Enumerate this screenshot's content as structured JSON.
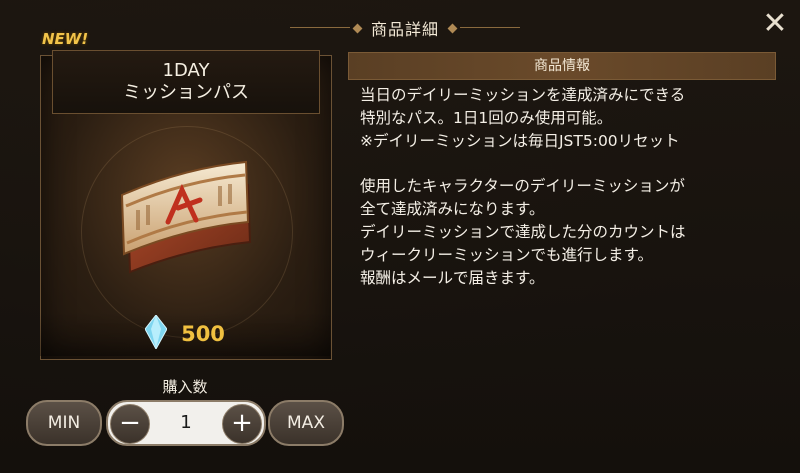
{
  "dialog": {
    "title": "商品詳細",
    "close_glyph": "✕"
  },
  "product": {
    "badge": "NEW!",
    "name_line1": "1DAY",
    "name_line2": "ミッションパス",
    "item_icon": "red-band-ticket-icon",
    "currency_icon": "crystal-icon",
    "price": "500"
  },
  "quantity": {
    "label": "購入数",
    "min_label": "MIN",
    "max_label": "MAX",
    "minus": "−",
    "plus": "+",
    "value": "1"
  },
  "info": {
    "header": "商品情報",
    "para1": [
      "当日のデイリーミッションを達成済みにできる",
      "特別なパス。1日1回のみ使用可能。",
      "※デイリーミッションは毎日JST5:00リセット"
    ],
    "para2": [
      "使用したキャラクターのデイリーミッションが",
      "全て達成済みになります。",
      "デイリーミッションで達成した分のカウントは",
      "ウィークリーミッションでも進行します。",
      "報酬はメールで届きます。"
    ]
  },
  "colors": {
    "accent_gold": "#f0c040",
    "header_brown": "#6a4a2a"
  }
}
